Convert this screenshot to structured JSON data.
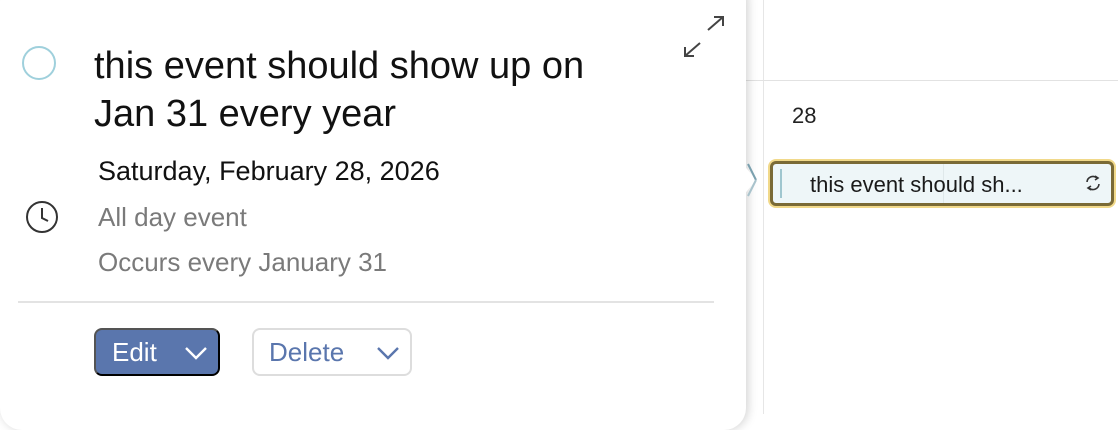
{
  "calendar": {
    "day_number": "28",
    "event_chip": {
      "title": "this event should sh...",
      "icon": "repeat-icon",
      "border_color": "#7a6a36",
      "highlight_color": "#f1d98a",
      "fill_color": "#eef6f8"
    }
  },
  "popover": {
    "title": "this event should show up on Jan 31 every year",
    "date": "Saturday, February 28, 2026",
    "time_label": "All day event",
    "recurrence": "Occurs every January 31",
    "icons": {
      "status": "circle-checkbox-icon",
      "expand": "expand-icon",
      "time": "clock-icon"
    },
    "actions": {
      "edit_label": "Edit",
      "delete_label": "Delete"
    },
    "colors": {
      "accent": "#5a76ad",
      "circle": "#9fd0dc"
    }
  }
}
